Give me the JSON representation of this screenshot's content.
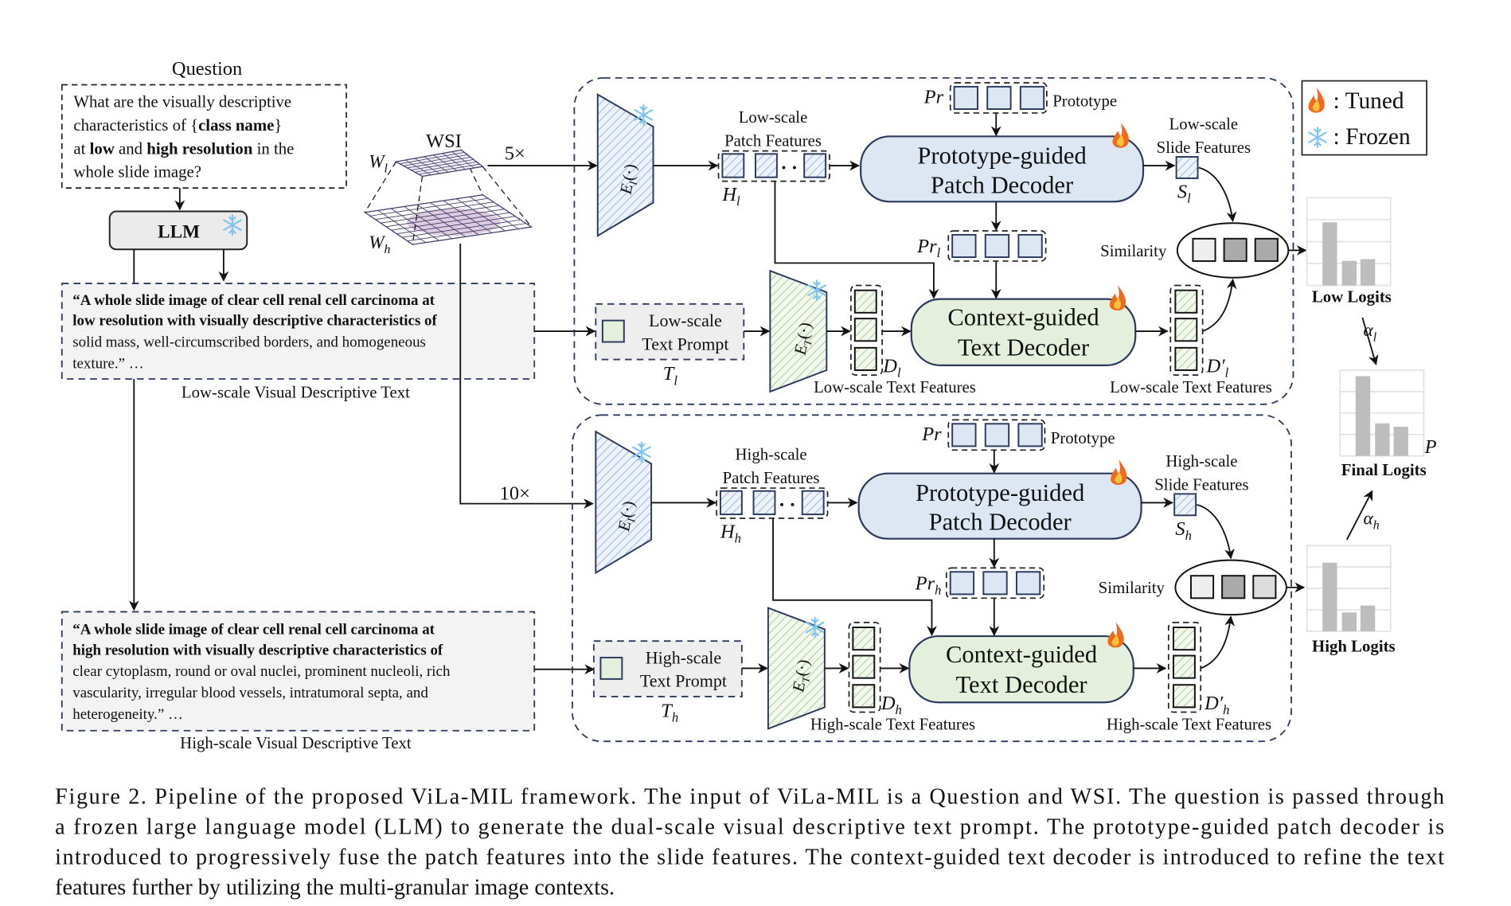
{
  "question": {
    "title": "Question",
    "l1": "What are the visually descriptive",
    "l2a": "characteristics of {",
    "l2b": "class name",
    "l2c": "}",
    "l3a": "at ",
    "l3b": "low",
    "l3c": " and ",
    "l3d": "high resolution",
    "l3e": " in the",
    "l4": "whole slide image?"
  },
  "llm": {
    "label": "LLM"
  },
  "wsi": {
    "label": "WSI",
    "wl": "W",
    "wl_sub": "l",
    "wh": "W",
    "wh_sub": "h",
    "low_mag": "5×",
    "high_mag": "10×"
  },
  "low_text": {
    "l1": "“A whole slide image of clear cell renal cell carcinoma at",
    "l2": "low resolution with visually descriptive characteristics of",
    "l3": "solid mass, well-circumscribed borders, and homogeneous",
    "l4": "texture.” …",
    "caption": "Low-scale Visual Descriptive Text"
  },
  "high_text": {
    "l1": "“A whole slide image of clear cell renal cell carcinoma at",
    "l2": "high resolution with visually descriptive characteristics of",
    "l3": "clear cytoplasm, round or oval nuclei, prominent nucleoli, rich",
    "l4": "vascularity, irregular blood vessels, intratumoral septa, and",
    "l5": "heterogeneity.” …",
    "caption": "High-scale Visual Descriptive Text"
  },
  "low_branch": {
    "image_encoder": "E",
    "image_encoder_sub": "I",
    "image_encoder_arg": "(·)",
    "patch_label_1": "Low-scale",
    "patch_label_2": "Patch Features",
    "patch_symbol": "H",
    "patch_sub": "l",
    "prototype_symbol": "Pr",
    "prototype_label": "Prototype",
    "patch_decoder_1": "Prototype-guided",
    "patch_decoder_2": "Patch Decoder",
    "slide_label_1": "Low-scale",
    "slide_label_2": "Slide Features",
    "slide_symbol": "S",
    "slide_sub": "l",
    "proto_out_symbol": "Pr",
    "proto_out_sub": "l",
    "prompt_label_1": "Low-scale",
    "prompt_label_2": "Text Prompt",
    "prompt_symbol": "T",
    "prompt_sub": "l",
    "text_encoder": "E",
    "text_encoder_sub": "T",
    "text_encoder_arg": "(·)",
    "text_feat_symbol": "D",
    "text_feat_sub": "l",
    "text_feat_label": "Low-scale Text Features",
    "text_decoder_1": "Context-guided",
    "text_decoder_2": "Text Decoder",
    "refined_symbol": "D′",
    "refined_sub": "l",
    "refined_label": "Low-scale Text Features",
    "similarity": "Similarity",
    "similarity_colors": [
      "#eeeeee",
      "#aaaaaa",
      "#aaaaaa"
    ]
  },
  "high_branch": {
    "image_encoder": "E",
    "image_encoder_sub": "I",
    "image_encoder_arg": "(·)",
    "patch_label_1": "High-scale",
    "patch_label_2": "Patch Features",
    "patch_symbol": "H",
    "patch_sub": "h",
    "prototype_symbol": "Pr",
    "prototype_label": "Prototype",
    "patch_decoder_1": "Prototype-guided",
    "patch_decoder_2": "Patch Decoder",
    "slide_label_1": "High-scale",
    "slide_label_2": "Slide Features",
    "slide_symbol": "S",
    "slide_sub": "h",
    "proto_out_symbol": "Pr",
    "proto_out_sub": "h",
    "prompt_label_1": "High-scale",
    "prompt_label_2": "Text Prompt",
    "prompt_symbol": "T",
    "prompt_sub": "h",
    "text_encoder": "E",
    "text_encoder_sub": "T",
    "text_encoder_arg": "(·)",
    "text_feat_symbol": "D",
    "text_feat_sub": "h",
    "text_feat_label": "High-scale Text Features",
    "text_decoder_1": "Context-guided",
    "text_decoder_2": "Text Decoder",
    "refined_symbol": "D′",
    "refined_sub": "h",
    "refined_label": "High-scale Text Features",
    "similarity": "Similarity",
    "similarity_colors": [
      "#eeeeee",
      "#aaaaaa",
      "#dddddd"
    ]
  },
  "legend": {
    "tuned": ": Tuned",
    "frozen": ": Frozen",
    "tuned_icon": "flame-icon",
    "frozen_icon": "snowflake-icon"
  },
  "logits": {
    "low": {
      "label": "Low Logits",
      "values": [
        0.72,
        0.28,
        0.3
      ]
    },
    "final": {
      "label": "Final Logits",
      "symbol": "P",
      "values": [
        0.93,
        0.38,
        0.34
      ]
    },
    "high": {
      "label": "High Logits",
      "values": [
        0.8,
        0.22,
        0.3
      ]
    },
    "alpha_l": "α",
    "alpha_l_sub": "l",
    "alpha_h": "α",
    "alpha_h_sub": "h"
  },
  "colors": {
    "patch_decoder": "#dde7f4",
    "text_decoder": "#e4efdc",
    "outline": "#2c3a5e",
    "bar": "#bdbdbd"
  },
  "caption": {
    "l1": "Figure 2. Pipeline of the proposed ViLa-MIL framework. The input of ViLa-MIL is a Question and WSI. The question is passed through",
    "l2": "a frozen large language model (LLM) to generate the dual-scale visual descriptive text prompt. The prototype-guided patch decoder is",
    "l3": "introduced to progressively fuse the patch features into the slide features. The context-guided text decoder is introduced to refine the text",
    "l4": "features further by utilizing the multi-granular image contexts."
  }
}
